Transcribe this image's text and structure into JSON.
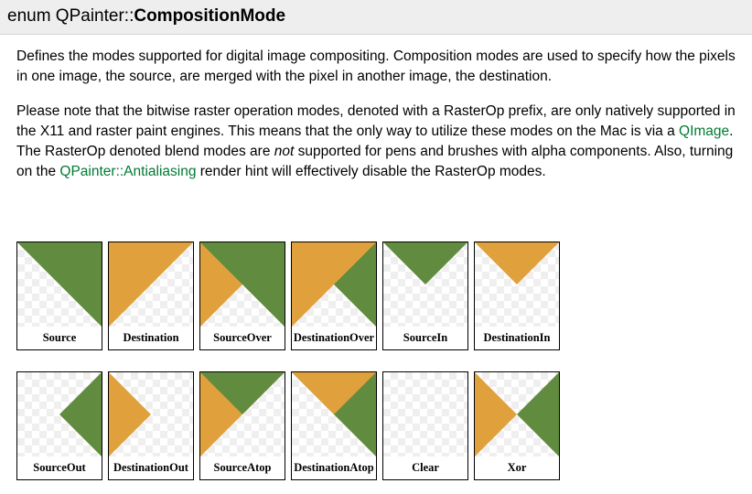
{
  "header": {
    "prefix": "enum QPainter::",
    "name": "CompositionMode"
  },
  "paragraphs": {
    "p1": "Defines the modes supported for digital image compositing. Composition modes are used to specify how the pixels in one image, the source, are merged with the pixel in another image, the destination.",
    "p2_a": "Please note that the bitwise raster operation modes, denoted with a RasterOp prefix, are only natively supported in the X11 and raster paint engines. This means that the only way to utilize these modes on the Mac is via a ",
    "p2_link1": "QImage",
    "p2_b": ". The RasterOp denoted blend modes are ",
    "p2_italic": "not",
    "p2_c": " supported for pens and brushes with alpha components. Also, turning on the ",
    "p2_link2": "QPainter::Antialiasing",
    "p2_d": " render hint will effectively disable the RasterOp modes."
  },
  "colors": {
    "source_green": "#618c40",
    "destination_orange": "#e0a13c",
    "link_green": "#007a33",
    "header_bg": "#eeeeee",
    "checker_light": "#ffffff",
    "checker_dark": "#efefef"
  },
  "tiles": {
    "row1": [
      {
        "label": "Source",
        "shapes": [
          "green-diag-top-right"
        ]
      },
      {
        "label": "Destination",
        "shapes": [
          "orange-diag-top-left"
        ]
      },
      {
        "label": "SourceOver",
        "shapes": [
          "orange-diag-top-left",
          "green-diag-top-right"
        ]
      },
      {
        "label": "DestinationOver",
        "shapes": [
          "green-diag-top-right",
          "orange-diag-top-left"
        ]
      },
      {
        "label": "SourceIn",
        "shapes": [
          "green-wedge-down"
        ]
      },
      {
        "label": "DestinationIn",
        "shapes": [
          "orange-wedge-down"
        ]
      }
    ],
    "row2": [
      {
        "label": "SourceOut",
        "shapes": [
          "green-wedge-left"
        ]
      },
      {
        "label": "DestinationOut",
        "shapes": [
          "orange-wedge-right"
        ]
      },
      {
        "label": "SourceAtop",
        "shapes": [
          "orange-wedge-left-full",
          "green-wedge-down"
        ]
      },
      {
        "label": "DestinationAtop",
        "shapes": [
          "green-wedge-right-full",
          "orange-wedge-down"
        ]
      },
      {
        "label": "Clear",
        "shapes": []
      },
      {
        "label": "Xor",
        "shapes": [
          "orange-wedge-right",
          "green-wedge-left"
        ]
      }
    ]
  }
}
